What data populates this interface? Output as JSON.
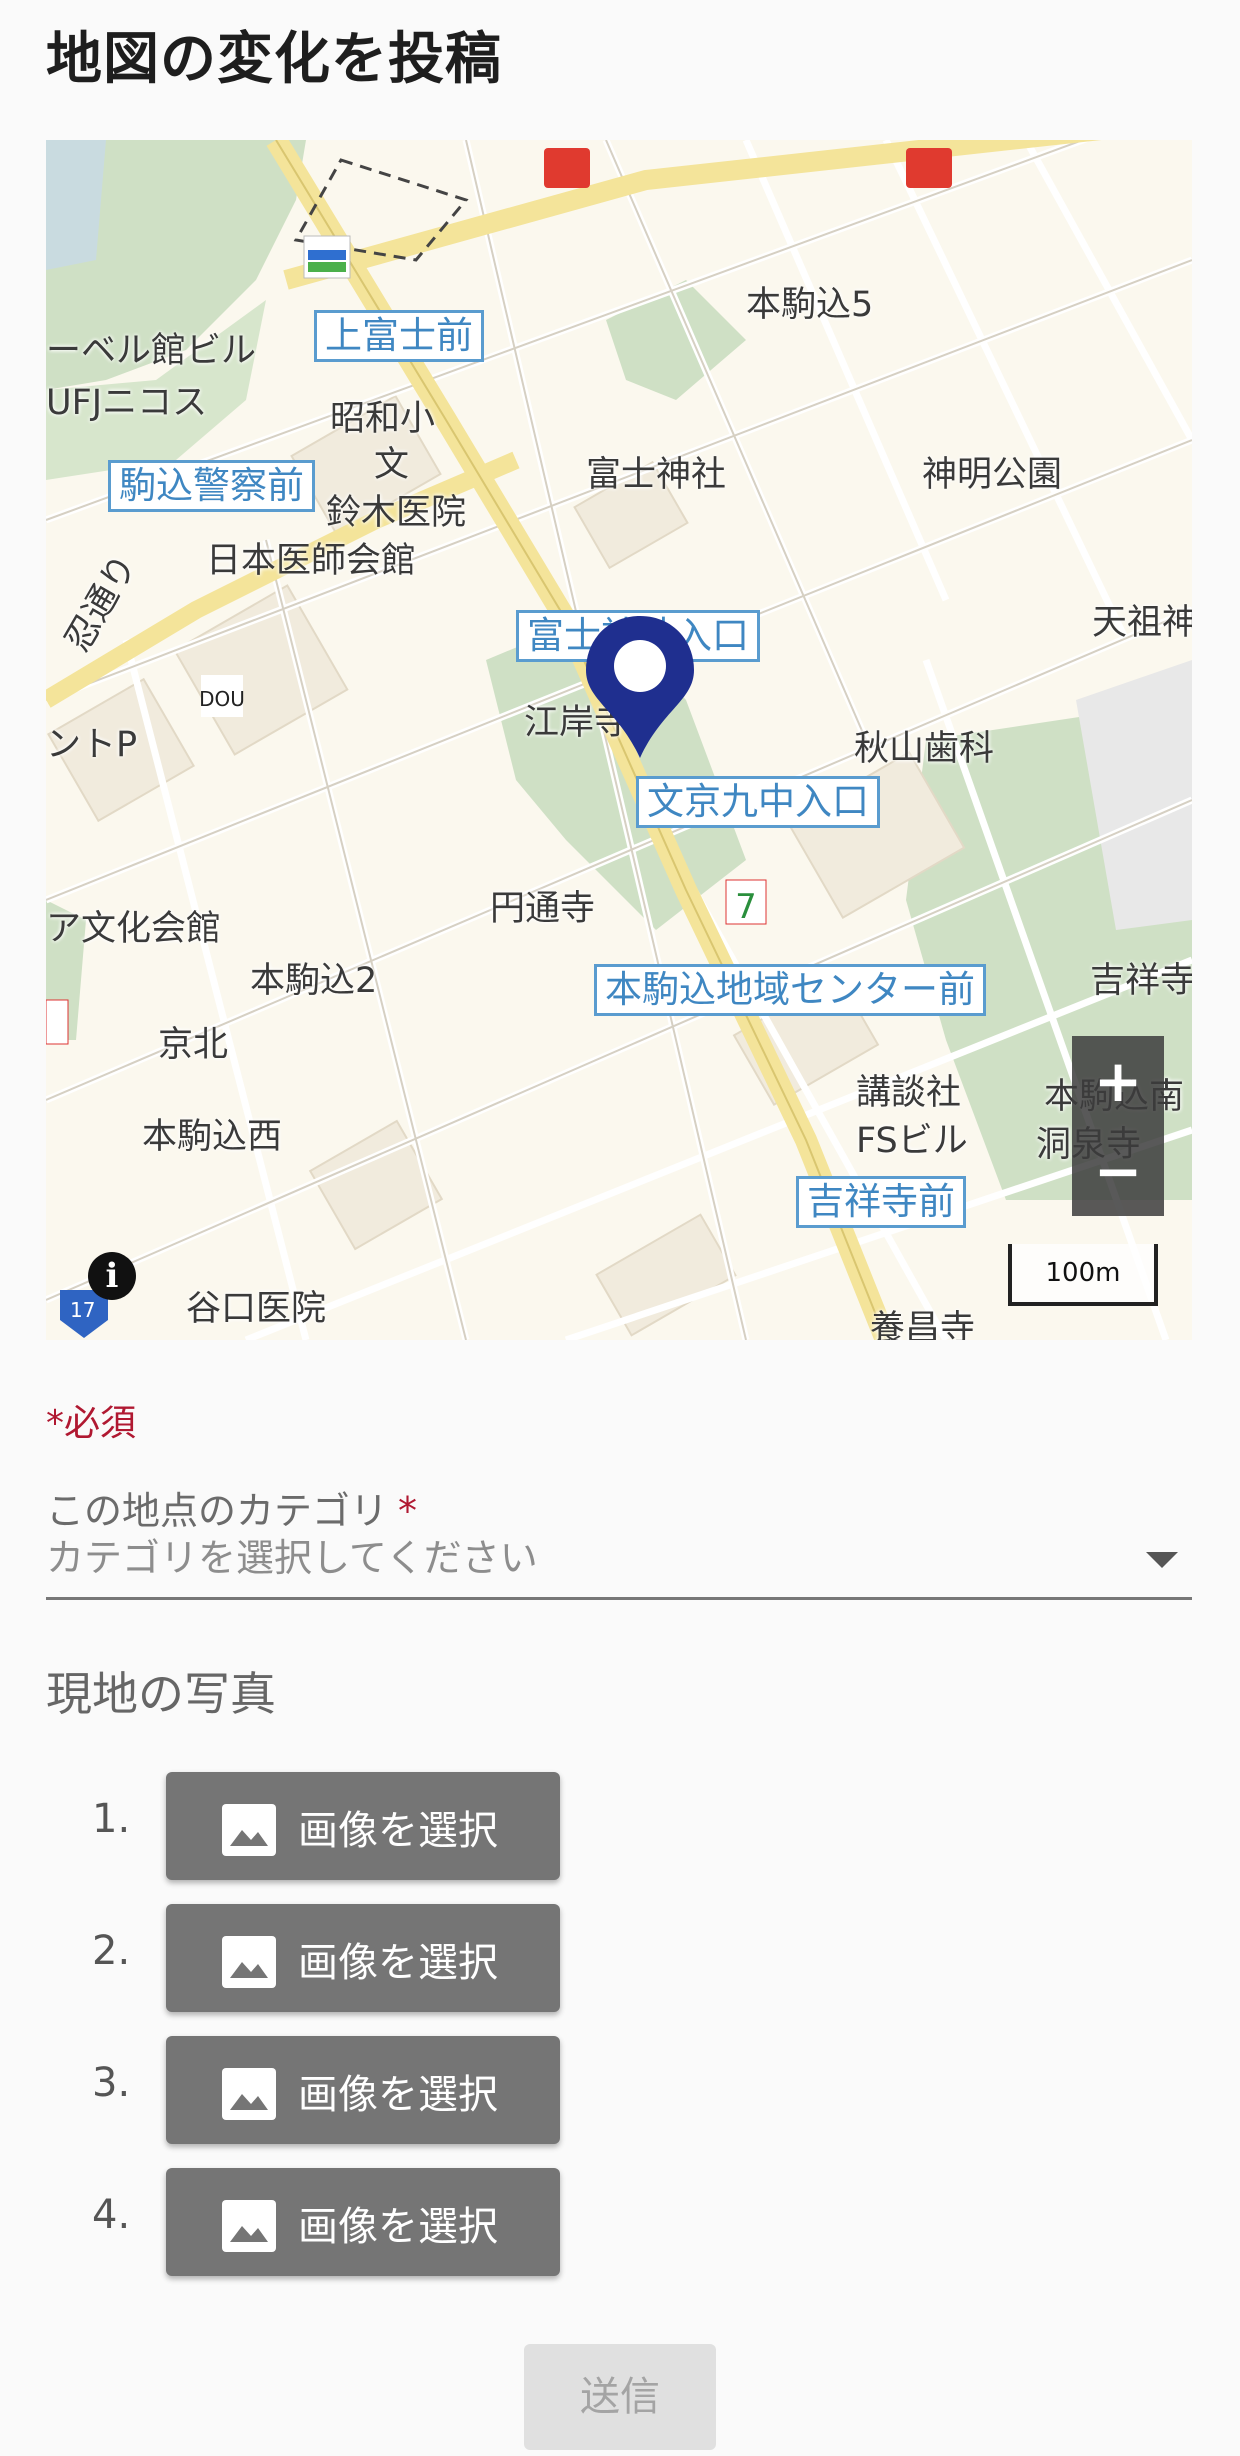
{
  "page": {
    "title": "地図の変化を投稿"
  },
  "map": {
    "labels": {
      "hon_komagome5": "本駒込5",
      "fuji_shrine": "富士神社",
      "shinmei_park": "神明公園",
      "tenso": "天祖神",
      "showa_elementary": "昭和小",
      "bun": "文",
      "suzuki_hospital": "鈴木医院",
      "nihon_ishikaikan": "日本医師会館",
      "nobel_bldg": "ーベル館ビル",
      "ufj_nicos": "UFJニコス",
      "dori": "忍通り",
      "parking": "ントP",
      "kouganji": "江岸寺",
      "akiyama_dental": "秋山歯科",
      "entsuji": "円通寺",
      "bunka_kaikan": "ア文化会館",
      "hon_komagome2": "本駒込2",
      "kyohoku": "京北",
      "hon_komagome_west": "本駒込西",
      "kodansha": "講談社",
      "fs_bldg": "FSビル",
      "kichijoji_temple": "吉祥寺",
      "hon_komagome_s": "本駒込南",
      "senpoji": "洞泉寺",
      "taniguchi_hospital": "谷口医院",
      "yoshoji": "養昌寺",
      "route": "17"
    },
    "stops": {
      "kamifujimae": "上富士前",
      "komagome_police": "駒込警察前",
      "fuji_shrine_entrance": "富士神社入口",
      "bunkyo9": "文京九中入口",
      "community_center": "本駒込地域センター前",
      "kichijojimae": "吉祥寺前"
    },
    "zoom_in": "+",
    "zoom_out": "−",
    "scale": "100m",
    "info": "i"
  },
  "form": {
    "required_note": "*必須",
    "category_label": "この地点のカテゴリ",
    "category_star": "*",
    "category_placeholder": "カテゴリを選択してください",
    "photos_title": "現地の写真",
    "photo_rows": [
      {
        "num": "1.",
        "label": "画像を選択"
      },
      {
        "num": "2.",
        "label": "画像を選択"
      },
      {
        "num": "3.",
        "label": "画像を選択"
      },
      {
        "num": "4.",
        "label": "画像を選択"
      }
    ],
    "submit_label": "送信"
  },
  "colors": {
    "accent_required": "#b01831",
    "map_box_label": "#3f87c2",
    "pin": "#1f2f8f",
    "button_bg": "#757575"
  }
}
